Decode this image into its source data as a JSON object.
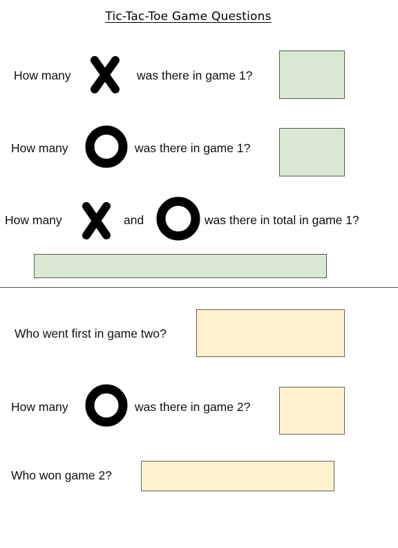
{
  "title": "Tic-Tac-Toe Game Questions",
  "section_game1": {
    "q1": {
      "prefix": "How many",
      "icon": "x-icon",
      "suffix": "was there in game 1?",
      "answer_color": "#d9e8d2"
    },
    "q2": {
      "prefix": "How many",
      "icon": "o-icon",
      "suffix": "was there in game 1?",
      "answer_color": "#d9e8d2"
    },
    "q3": {
      "prefix": "How many",
      "icon1": "x-icon",
      "middle": "and",
      "icon2": "o-icon",
      "suffix": "was there in total in game 1?",
      "answer_color": "#d9e8d2"
    }
  },
  "section_game2": {
    "q4": {
      "text": "Who went first in game two?",
      "answer_color": "#fff2cd"
    },
    "q5": {
      "prefix": "How many",
      "icon": "o-icon",
      "suffix": "was there in game 2?",
      "answer_color": "#fff2cd"
    },
    "q6": {
      "text": "Who won game 2?",
      "answer_color": "#fff2cd"
    }
  }
}
